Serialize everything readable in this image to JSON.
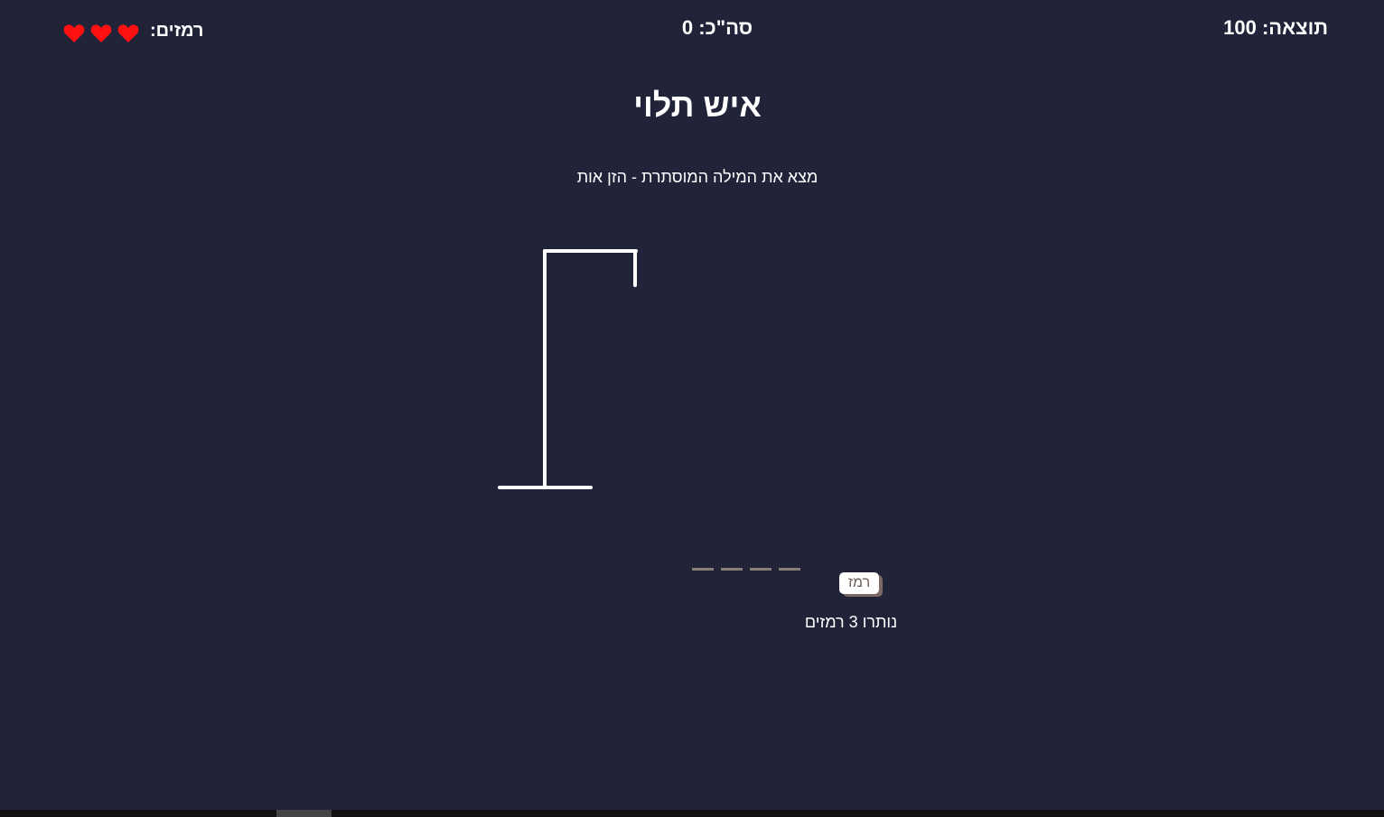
{
  "header": {
    "score_text": "תוצאה: 100",
    "total_text": "סה\"כ: 0",
    "hints_label": "רמזים:",
    "hearts": [
      "heart-icon",
      "heart-icon",
      "heart-icon"
    ],
    "heart_color": "#ff1111"
  },
  "game": {
    "title": "איש תלוי",
    "instruction": "מצא את המילה המוסתרת - הזן אות",
    "word_slots": [
      "",
      "",
      "",
      ""
    ],
    "hint_button_label": "רמז",
    "hints_remaining_text": "נותרו 3 רמזים"
  },
  "colors": {
    "background": "#212338",
    "text": "#ffffff",
    "slot": "#8a7f78"
  }
}
